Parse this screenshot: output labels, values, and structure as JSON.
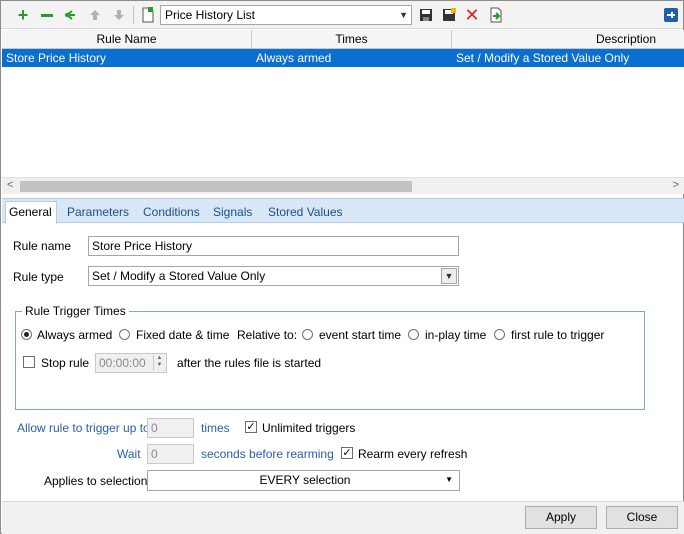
{
  "toolbar": {
    "list_name": "Price History List",
    "icons": [
      "add-icon",
      "remove-icon",
      "branch-icon",
      "move-up-icon",
      "move-down-icon",
      "new-file-icon",
      "save-icon",
      "save-as-icon",
      "delete-icon",
      "export-icon",
      "pin-icon"
    ],
    "colors": {
      "add": "#2a9a2a",
      "delete": "#d9261c",
      "arrow_disabled": "#a9b3bd"
    }
  },
  "grid": {
    "columns": [
      "Rule Name",
      "Times",
      "Description"
    ],
    "rows": [
      {
        "rule_name": "Store Price History",
        "times": "Always armed",
        "description": "Set / Modify a Stored Value Only"
      }
    ],
    "selection_color": "#0b6ed1"
  },
  "tabs": [
    "General",
    "Parameters",
    "Conditions",
    "Signals",
    "Stored Values"
  ],
  "form": {
    "rule_name_label": "Rule name",
    "rule_name_value": "Store Price History",
    "rule_type_label": "Rule type",
    "rule_type_value": "Set / Modify a Stored Value Only",
    "trigger_group_title": "Rule Trigger Times",
    "always_armed": "Always armed",
    "fixed_date": "Fixed date & time",
    "relative_to": "Relative to:",
    "event_start": "event start time",
    "in_play": "in-play time",
    "first_rule": "first rule to trigger",
    "stop_rule": "Stop rule",
    "stop_time": "00:00:00",
    "after_started": "after the rules file is started",
    "allow_label": "Allow rule to trigger up to",
    "allow_value": "0",
    "times_label": "times",
    "unlimited_label": "Unlimited triggers",
    "wait_label": "Wait",
    "wait_value": "0",
    "seconds_label": "seconds before rearming",
    "rearm_label": "Rearm every refresh",
    "applies_label": "Applies to selection",
    "applies_value": "EVERY selection"
  },
  "buttons": {
    "apply": "Apply",
    "close": "Close"
  }
}
